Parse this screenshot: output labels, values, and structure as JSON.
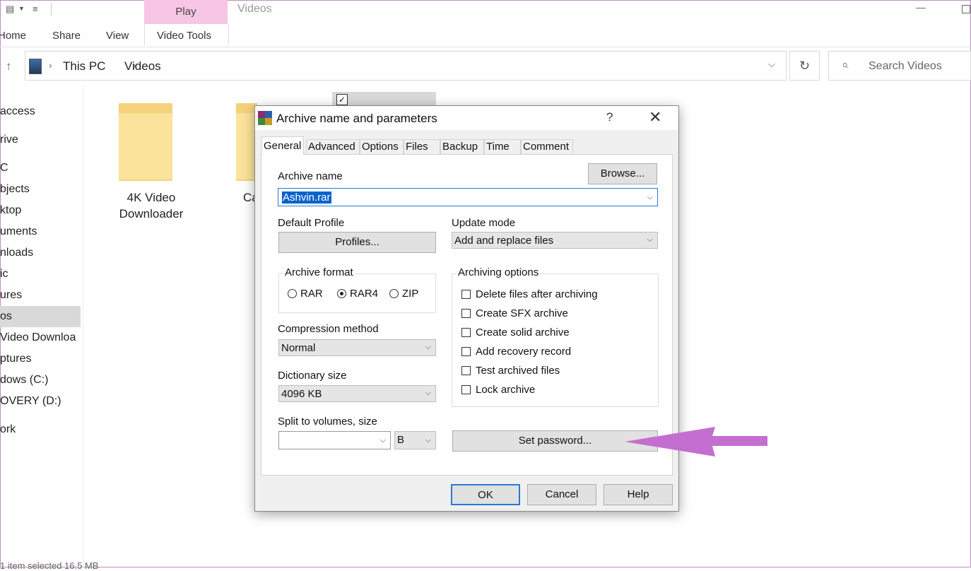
{
  "ribbon": {
    "context_tab": "Play",
    "window_title": "Videos",
    "tabs": [
      "Home",
      "Share",
      "View",
      "Video Tools"
    ]
  },
  "address": {
    "path": [
      "This PC",
      "Videos"
    ],
    "search_placeholder": "Search Videos"
  },
  "nav": {
    "items": [
      "access",
      "rive",
      "C",
      "bjects",
      "ktop",
      "uments",
      "nloads",
      "ic",
      "ures",
      "os",
      "Video Downloa",
      "ptures",
      "dows (C:)",
      "OVERY (D:)",
      "ork"
    ],
    "selected_index": 9
  },
  "files": {
    "items": [
      {
        "label_line1": "4K Video",
        "label_line2": "Downloader"
      },
      {
        "label_line1": "Ca"
      }
    ]
  },
  "status_bar": "1 item selected  16.5 MB",
  "dialog": {
    "title": "Archive name and parameters",
    "help_glyph": "?",
    "tabs": [
      "General",
      "Advanced",
      "Options",
      "Files",
      "Backup",
      "Time",
      "Comment"
    ],
    "active_tab": "General",
    "archive_name_label": "Archive name",
    "browse_button": "Browse...",
    "archive_name_value": "Ashvin.rar",
    "default_profile_label": "Default Profile",
    "profiles_button": "Profiles...",
    "update_mode_label": "Update mode",
    "update_mode_value": "Add and replace files",
    "archive_format_label": "Archive format",
    "formats": [
      "RAR",
      "RAR4",
      "ZIP"
    ],
    "selected_format": "RAR4",
    "compression_method_label": "Compression method",
    "compression_method_value": "Normal",
    "dictionary_size_label": "Dictionary size",
    "dictionary_size_value": "4096 KB",
    "split_label": "Split to volumes, size",
    "split_value": "",
    "split_unit": "B",
    "archiving_options_label": "Archiving options",
    "archiving_options": [
      {
        "label": "Delete files after archiving",
        "checked": false
      },
      {
        "label": "Create SFX archive",
        "checked": false
      },
      {
        "label": "Create solid archive",
        "checked": false
      },
      {
        "label": "Add recovery record",
        "checked": false
      },
      {
        "label": "Test archived files",
        "checked": false
      },
      {
        "label": "Lock archive",
        "checked": false
      }
    ],
    "set_password_button": "Set password...",
    "ok_button": "OK",
    "cancel_button": "Cancel",
    "help_button": "Help"
  },
  "colors": {
    "accent": "#2b79d6",
    "context_tab": "#f7c6e4",
    "annotation_arrow": "#c46fcf",
    "folder": "#f3d27a"
  }
}
